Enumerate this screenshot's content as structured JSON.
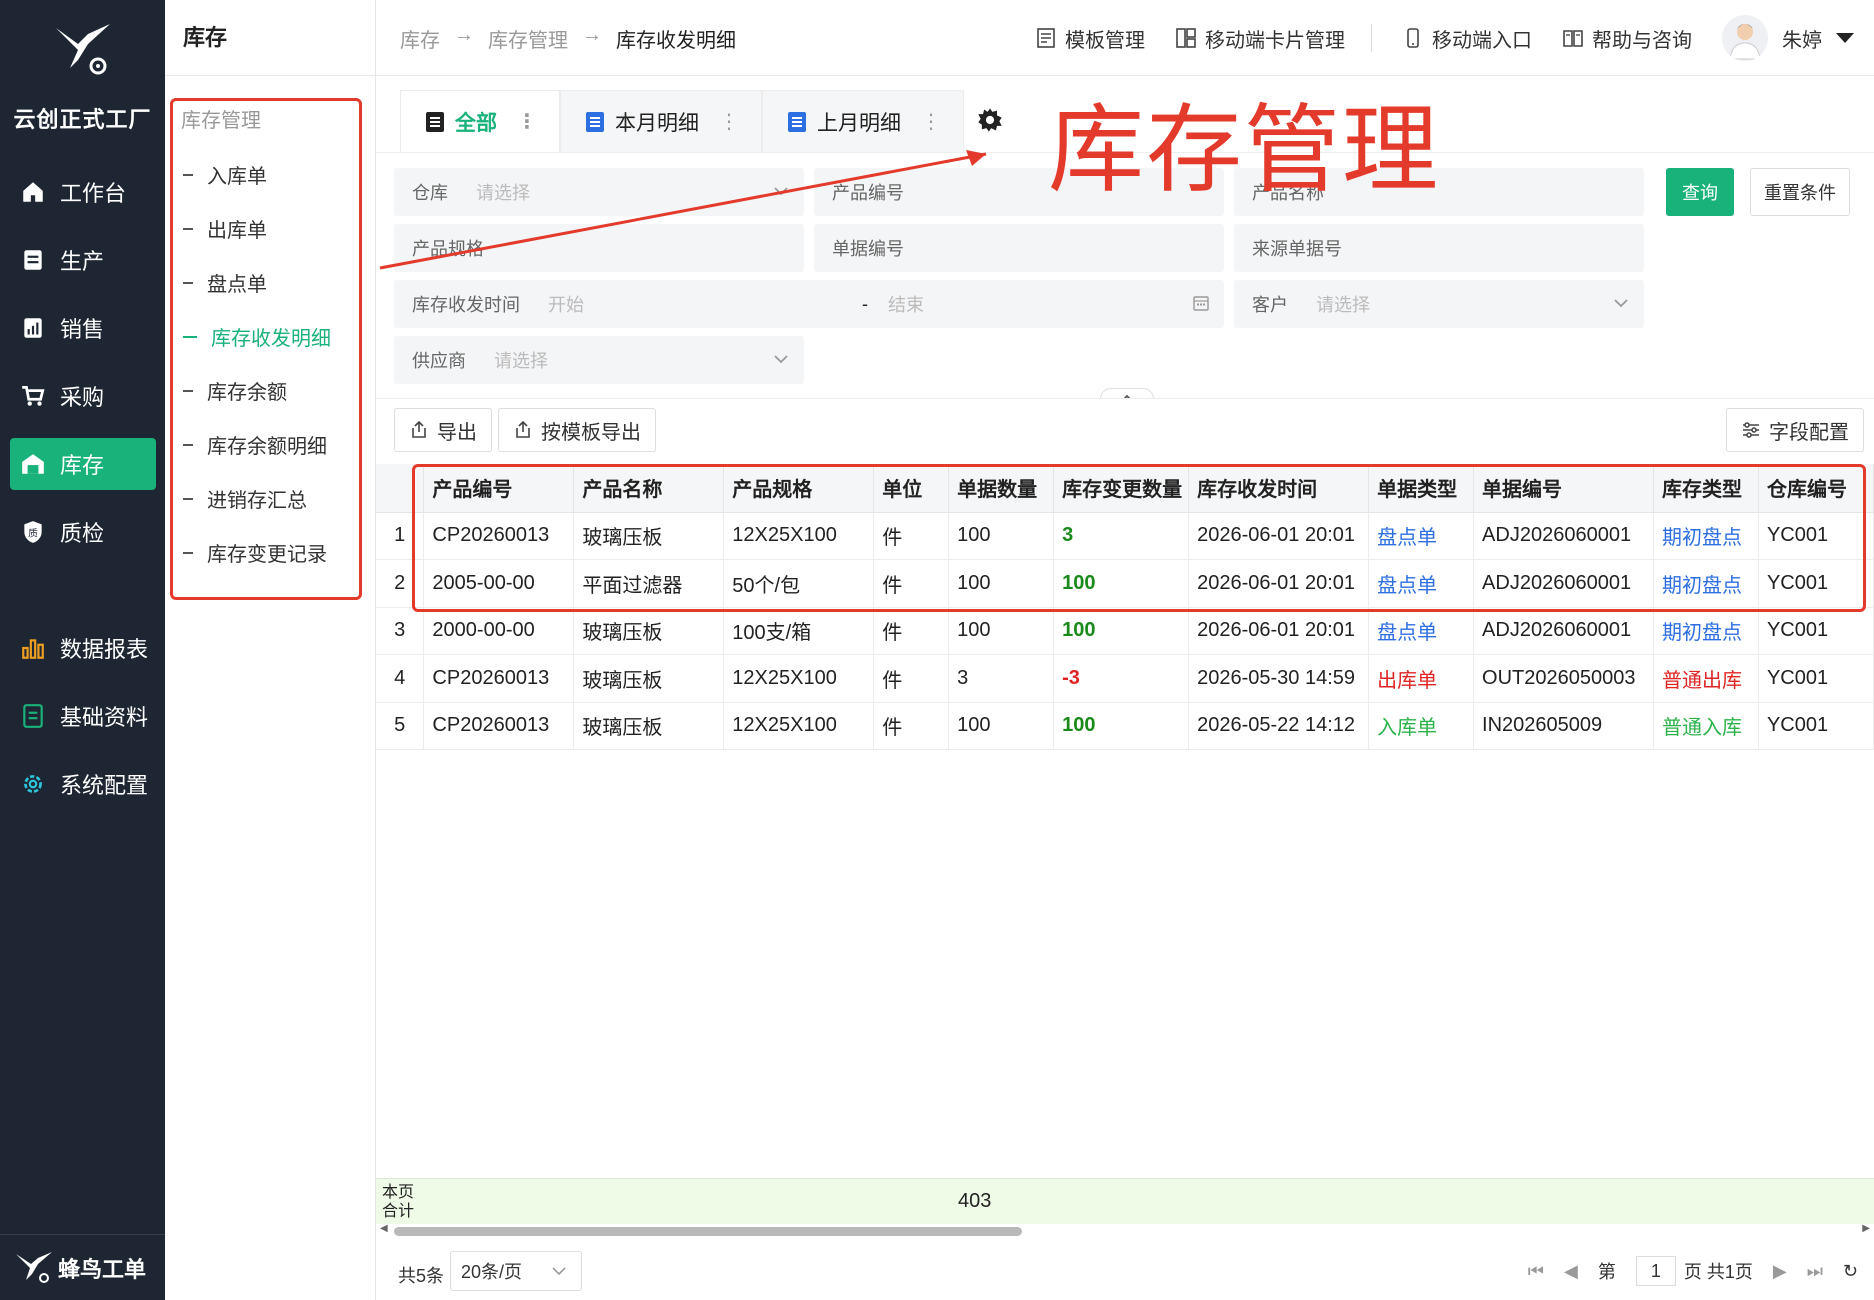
{
  "brand": {
    "name": "云创正式工厂",
    "footer": "蜂鸟工单"
  },
  "nav": [
    {
      "label": "工作台",
      "icon": "home-icon"
    },
    {
      "label": "生产",
      "icon": "production-icon"
    },
    {
      "label": "销售",
      "icon": "sales-icon"
    },
    {
      "label": "采购",
      "icon": "cart-icon"
    },
    {
      "label": "库存",
      "icon": "warehouse-icon"
    },
    {
      "label": "质检",
      "icon": "quality-shield-icon"
    },
    {
      "label": "数据报表",
      "icon": "bar-chart-icon"
    },
    {
      "label": "基础资料",
      "icon": "document-icon"
    },
    {
      "label": "系统配置",
      "icon": "gear-icon"
    }
  ],
  "submenu": {
    "title": "库存",
    "group": "库存管理",
    "items": [
      "入库单",
      "出库单",
      "盘点单",
      "库存收发明细",
      "库存余额",
      "库存余额明细",
      "进销存汇总",
      "库存变更记录"
    ]
  },
  "breadcrumb": [
    "库存",
    "库存管理",
    "库存收发明细"
  ],
  "breadcrumb_sep": "→",
  "toplinks": [
    "模板管理",
    "移动端卡片管理",
    "移动端入口",
    "帮助与咨询"
  ],
  "user": {
    "name": "朱婷"
  },
  "tabs": [
    {
      "label": "全部"
    },
    {
      "label": "本月明细"
    },
    {
      "label": "上月明细"
    }
  ],
  "annotation": "库存管理",
  "filters": {
    "warehouse": {
      "label": "仓库",
      "placeholder": "请选择"
    },
    "product_code": {
      "label": "产品编号"
    },
    "product_name": {
      "label": "产品名称"
    },
    "product_spec": {
      "label": "产品规格"
    },
    "doc_no": {
      "label": "单据编号"
    },
    "source_doc_no": {
      "label": "来源单据号"
    },
    "time": {
      "label": "库存收发时间",
      "start": "开始",
      "sep": "-",
      "end": "结束"
    },
    "customer": {
      "label": "客户",
      "placeholder": "请选择"
    },
    "supplier": {
      "label": "供应商",
      "placeholder": "请选择"
    },
    "query": "查询",
    "reset": "重置条件"
  },
  "toolbar": {
    "export": "导出",
    "export_template": "按模板导出",
    "field_config": "字段配置"
  },
  "table": {
    "columns": [
      "产品编号",
      "产品名称",
      "产品规格",
      "单位",
      "单据数量",
      "库存变更数量",
      "库存收发时间",
      "单据类型",
      "单据编号",
      "库存类型",
      "仓库编号"
    ],
    "rows": [
      {
        "idx": "1",
        "code": "CP20260013",
        "name": "玻璃压板",
        "spec": "12X25X100",
        "unit": "件",
        "qty": "100",
        "change": "3",
        "time": "2026-06-01 20:01",
        "doc_type": "盘点单",
        "doc_no": "ADJ2026060001",
        "stock_type": "期初盘点",
        "wh": "YC001"
      },
      {
        "idx": "2",
        "code": "2005-00-00",
        "name": "平面过滤器",
        "spec": "50个/包",
        "unit": "件",
        "qty": "100",
        "change": "100",
        "time": "2026-06-01 20:01",
        "doc_type": "盘点单",
        "doc_no": "ADJ2026060001",
        "stock_type": "期初盘点",
        "wh": "YC001"
      },
      {
        "idx": "3",
        "code": "2000-00-00",
        "name": "玻璃压板",
        "spec": "100支/箱",
        "unit": "件",
        "qty": "100",
        "change": "100",
        "time": "2026-06-01 20:01",
        "doc_type": "盘点单",
        "doc_no": "ADJ2026060001",
        "stock_type": "期初盘点",
        "wh": "YC001"
      },
      {
        "idx": "4",
        "code": "CP20260013",
        "name": "玻璃压板",
        "spec": "12X25X100",
        "unit": "件",
        "qty": "3",
        "change": "-3",
        "time": "2026-05-30 14:59",
        "doc_type": "出库单",
        "doc_no": "OUT2026050003",
        "stock_type": "普通出库",
        "wh": "YC001"
      },
      {
        "idx": "5",
        "code": "CP20260013",
        "name": "玻璃压板",
        "spec": "12X25X100",
        "unit": "件",
        "qty": "100",
        "change": "100",
        "time": "2026-05-22 14:12",
        "doc_type": "入库单",
        "doc_no": "IN202605009",
        "stock_type": "普通入库",
        "wh": "YC001"
      }
    ],
    "total_label_1": "本页",
    "total_label_2": "合计",
    "total_qty": "403"
  },
  "pager": {
    "count": "共5条",
    "size": "20条/页",
    "page_prefix": "第",
    "page": "1",
    "page_suffix": "页 共1页"
  },
  "colors": {
    "accent": "#19b27a",
    "nav_bg": "#1f2633",
    "annotation": "#e43a2c"
  }
}
